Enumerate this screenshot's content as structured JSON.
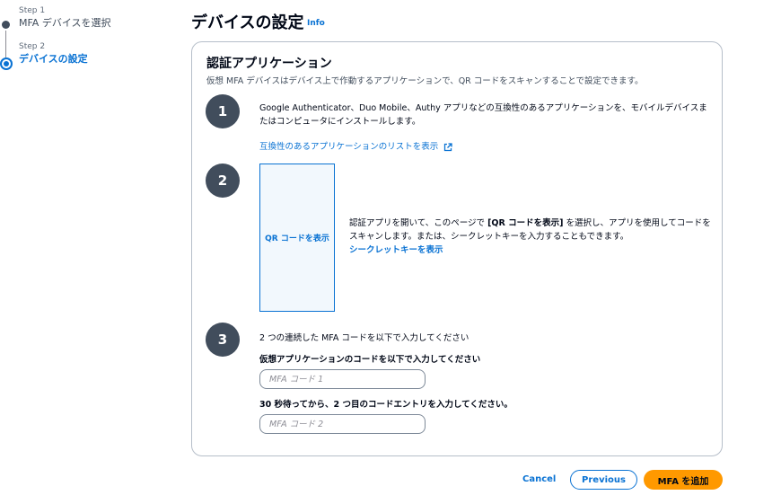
{
  "stepper": {
    "steps": [
      {
        "number": "Step 1",
        "title": "MFA デバイスを選択"
      },
      {
        "number": "Step 2",
        "title": "デバイスの設定"
      }
    ]
  },
  "header": {
    "title": "デバイスの設定",
    "info": "Info"
  },
  "card": {
    "title": "認証アプリケーション",
    "description": "仮想 MFA デバイスはデバイス上で作動するアプリケーションで、QR コードをスキャンすることで設定できます。",
    "step1": {
      "number": "1",
      "text": "Google Authenticator、Duo Mobile、Authy アプリなどの互換性のあるアプリケーションを、モバイルデバイスまたはコンピュータにインストールします。",
      "link": "互換性のあるアプリケーションのリストを表示"
    },
    "step2": {
      "number": "2",
      "qr_label": "QR コードを表示",
      "text_before": "認証アプリを開いて、このページで ",
      "text_bold": "[QR コードを表示]",
      "text_after": " を選択し、アプリを使用してコードをスキャンします。または、シークレットキーを入力することもできます。",
      "secret_link": "シークレットキーを表示"
    },
    "step3": {
      "number": "3",
      "text": "2 つの連続した MFA コードを以下で入力してください",
      "field1_label": "仮想アプリケーションのコードを以下で入力してください",
      "field1_placeholder": "MFA コード 1",
      "field2_label": "30 秒待ってから、2 つ目のコードエントリを入力してください。",
      "field2_placeholder": "MFA コード 2"
    }
  },
  "footer": {
    "cancel": "Cancel",
    "previous": "Previous",
    "submit": "MFA を追加"
  }
}
